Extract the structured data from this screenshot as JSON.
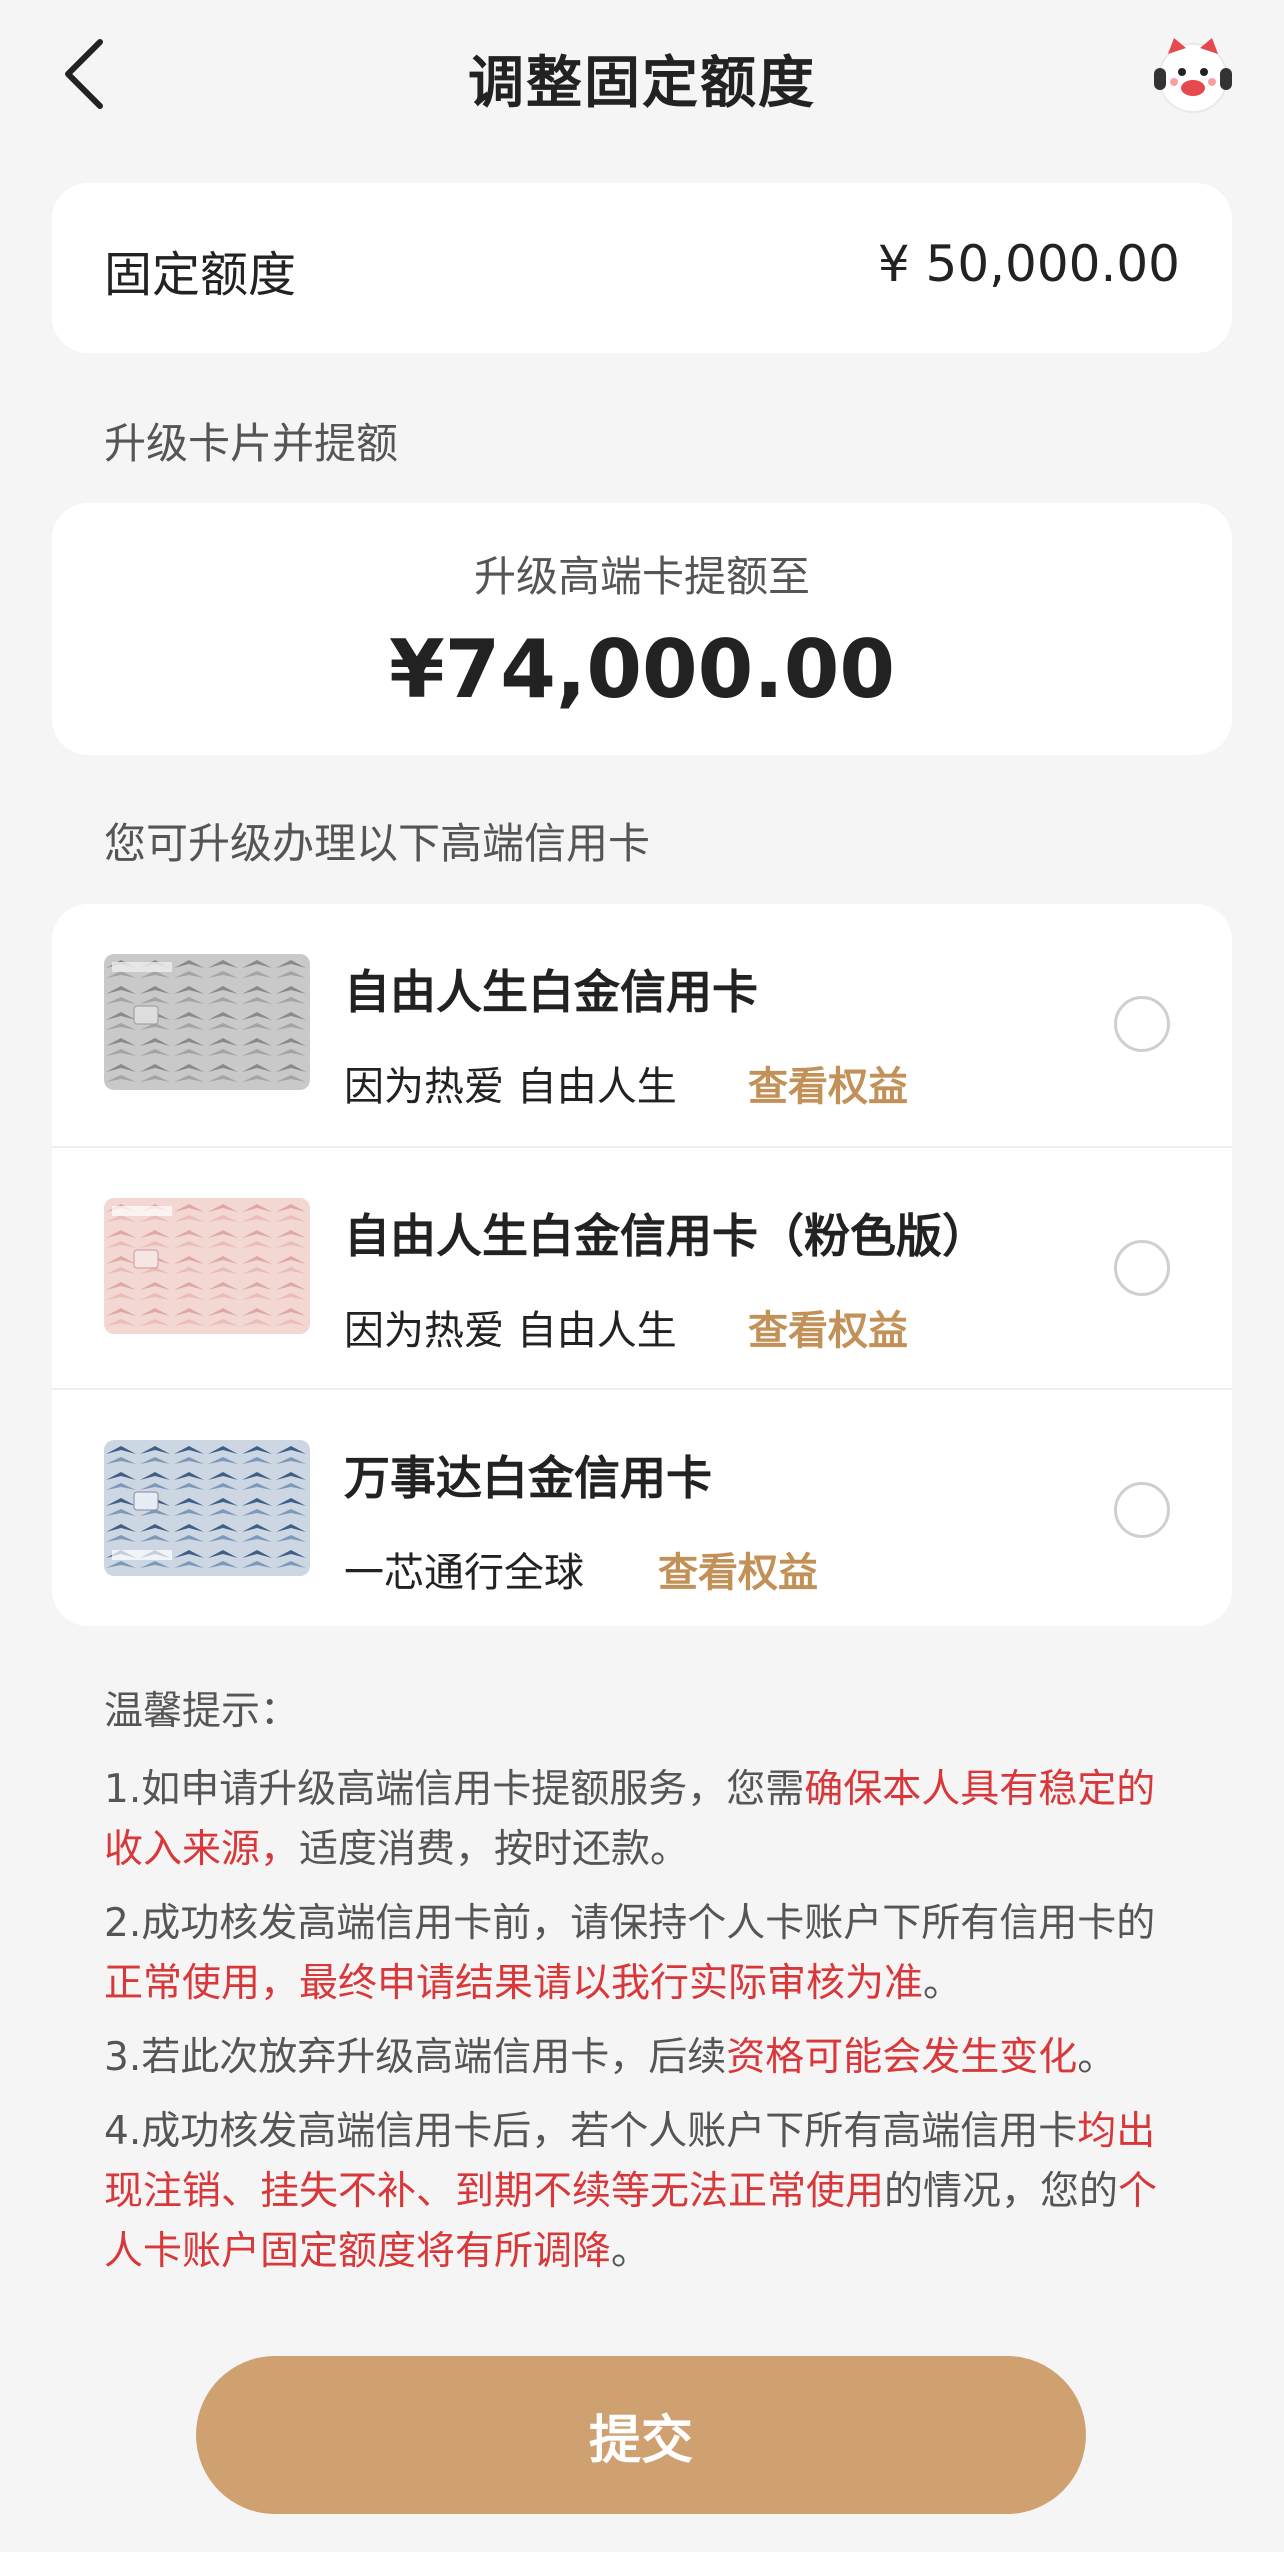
{
  "header": {
    "title": "调整固定额度",
    "back_icon": "chevron-left-icon",
    "mascot_icon": "mascot-avatar-icon"
  },
  "fixed_limit": {
    "label": "固定额度",
    "value": "¥ 50,000.00"
  },
  "upgrade_section_label": "升级卡片并提额",
  "upgrade": {
    "subtitle": "升级高端卡提额至",
    "amount": "¥74,000.00"
  },
  "cards_section_label": "您可升级办理以下高端信用卡",
  "cards": [
    {
      "name": "自由人生白金信用卡",
      "tagline": "因为热爱 自由人生",
      "link": "查看权益",
      "selected": false,
      "theme": "gray"
    },
    {
      "name": "自由人生白金信用卡（粉色版）",
      "tagline": "因为热爱 自由人生",
      "link": "查看权益",
      "selected": false,
      "theme": "pink"
    },
    {
      "name": "万事达白金信用卡",
      "tagline": "一芯通行全球",
      "link": "查看权益",
      "selected": false,
      "theme": "blue"
    }
  ],
  "tips": {
    "title": "温馨提示：",
    "items": [
      {
        "p1": "1.如申请升级高端信用卡提额服务，您需",
        "r1": "确保本人具有稳定的收入来源，",
        "p2": "适度消费，按时还款。",
        "r2": "",
        "p3": ""
      },
      {
        "p1": "2.成功核发高端信用卡前，请保持个人卡账户下所有信用卡的",
        "r1": "正常使用，最终申请结果请以我行实际审核为准",
        "p2": "。",
        "r2": "",
        "p3": ""
      },
      {
        "p1": "3.若此次放弃升级高端信用卡，后续",
        "r1": "资格可能会发生变化",
        "p2": "。",
        "r2": "",
        "p3": ""
      },
      {
        "p1": "4.成功核发高端信用卡后，若个人账户下所有高端信用卡",
        "r1": "均出现注销、挂失不补、到期不续等无法正常使用",
        "p2": "的情况，您的",
        "r2": "个人卡账户固定额度将有所调降",
        "p3": "。"
      }
    ]
  },
  "submit_label": "提交",
  "colors": {
    "accent": "#cfa170",
    "link": "#c29158",
    "warning": "#d9383a",
    "background": "#f5f5f5"
  }
}
